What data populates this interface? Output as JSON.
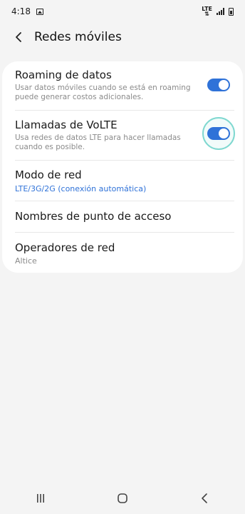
{
  "status_bar": {
    "time": "4:18",
    "network_label": "LTE"
  },
  "header": {
    "title": "Redes móviles"
  },
  "settings": {
    "roaming": {
      "title": "Roaming de datos",
      "description": "Usar datos móviles cuando se está en roaming puede generar costos adicionales.",
      "enabled": true
    },
    "volte": {
      "title": "Llamadas de VoLTE",
      "description": "Usa redes de datos LTE para hacer llamadas cuando es posible.",
      "enabled": true
    },
    "network_mode": {
      "title": "Modo de red",
      "value": "LTE/3G/2G (conexión automática)"
    },
    "apn": {
      "title": "Nombres de punto de acceso"
    },
    "operators": {
      "title": "Operadores de red",
      "value": "Altice"
    }
  },
  "colors": {
    "accent": "#2f72d8",
    "focus_ring": "#7fd8d0",
    "background": "#f4f4f4"
  },
  "icons": {
    "back": "chevron-left-icon",
    "recents": "recents-icon",
    "home": "home-icon",
    "nav_back": "back-icon"
  }
}
